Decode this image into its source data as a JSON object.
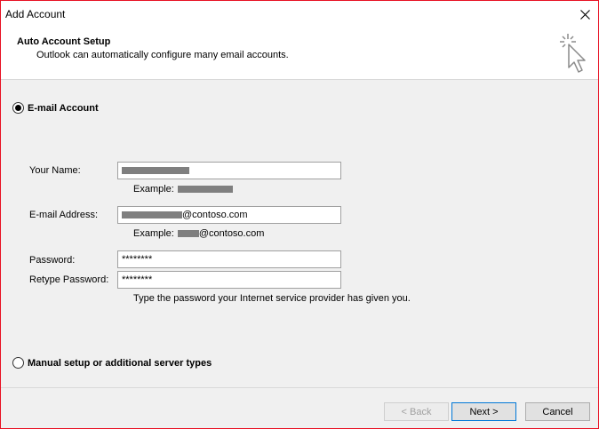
{
  "window": {
    "title": "Add Account"
  },
  "header": {
    "title": "Auto Account Setup",
    "subtitle": "Outlook can automatically configure many email accounts."
  },
  "email_option": {
    "label": "E-mail Account",
    "selected": true
  },
  "form": {
    "name": {
      "label": "Your Name:",
      "example_label": "Example:"
    },
    "email": {
      "label": "E-mail Address:",
      "value_domain": "@contoso.com",
      "example_label": "Example:",
      "example_domain": "@contoso.com"
    },
    "password": {
      "label": "Password:",
      "value": "********"
    },
    "retype": {
      "label": "Retype Password:",
      "value": "********"
    },
    "hint": "Type the password your Internet service provider has given you."
  },
  "manual_option": {
    "label": "Manual setup or additional server types",
    "selected": false
  },
  "buttons": {
    "back": "< Back",
    "next": "Next >",
    "cancel": "Cancel"
  }
}
